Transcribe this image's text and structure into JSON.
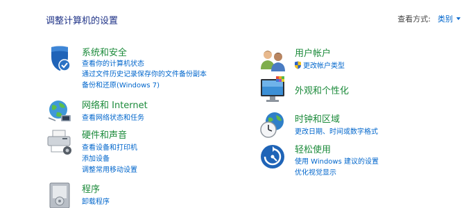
{
  "page": {
    "title": "调整计算机的设置",
    "view_by_label": "查看方式:",
    "view_by_value": "类别"
  },
  "left_categories": [
    {
      "icon": "system-security-icon",
      "title": "系统和安全",
      "links": [
        "查看你的计算机状态",
        "通过文件历史记录保存你的文件备份副本",
        "备份和还原(Windows 7)"
      ]
    },
    {
      "icon": "network-internet-icon",
      "title": "网络和 Internet",
      "links": [
        "查看网络状态和任务"
      ]
    },
    {
      "icon": "hardware-sound-icon",
      "title": "硬件和声音",
      "links": [
        "查看设备和打印机",
        "添加设备",
        "调整常用移动设置"
      ]
    },
    {
      "icon": "programs-icon",
      "title": "程序",
      "links": [
        "卸载程序"
      ]
    }
  ],
  "right_categories": [
    {
      "icon": "user-accounts-icon",
      "title": "用户帐户",
      "links": [
        "更改帐户类型"
      ]
    },
    {
      "icon": "appearance-personalization-icon",
      "title": "外观和个性化",
      "links": []
    },
    {
      "icon": "clock-region-icon",
      "title": "时钟和区域",
      "links": [
        "更改日期、时间或数字格式"
      ]
    },
    {
      "icon": "ease-of-access-icon",
      "title": "轻松使用",
      "links": [
        "使用 Windows 建议的设置",
        "优化视觉显示"
      ]
    }
  ],
  "colors": {
    "title_blue": "#1e3287",
    "category_green": "#1b8a3a",
    "link_blue": "#0066cc"
  }
}
